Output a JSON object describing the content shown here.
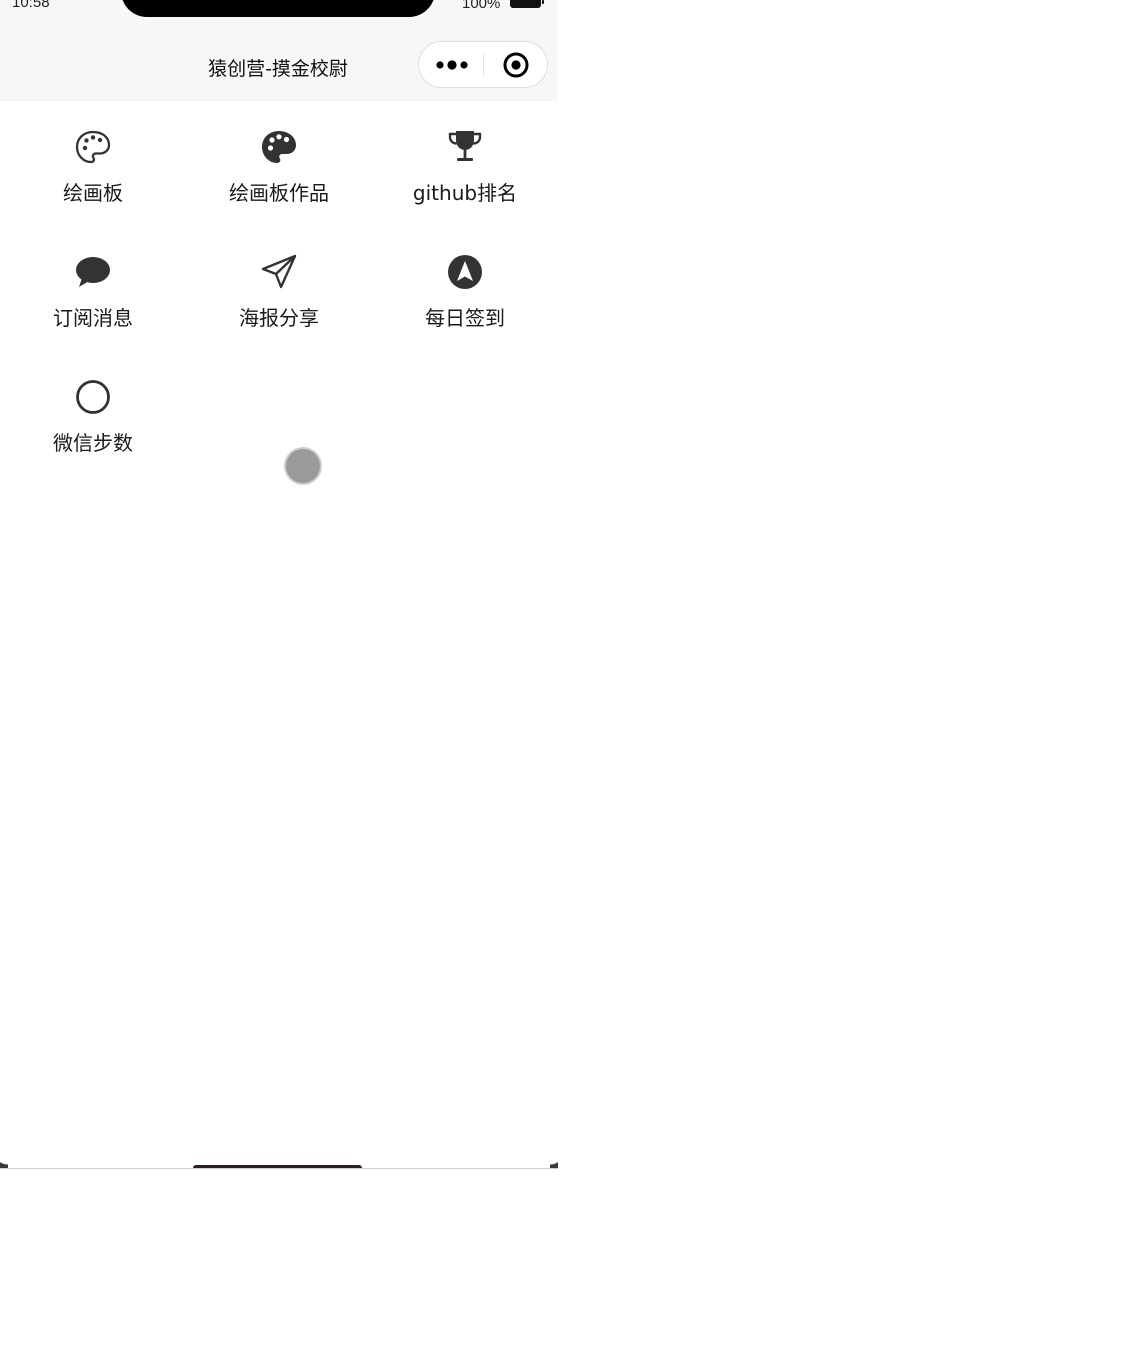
{
  "status_bar": {
    "time": "10:58",
    "battery_text": "100%"
  },
  "nav": {
    "title": "猿创营-摸金校尉",
    "more_icon": "more-dots-icon",
    "close_icon": "target-close-icon"
  },
  "menu": {
    "items": [
      {
        "label": "绘画板",
        "icon": "palette-outline-icon"
      },
      {
        "label": "绘画板作品",
        "icon": "palette-filled-icon"
      },
      {
        "label": "github排名",
        "icon": "trophy-icon"
      },
      {
        "label": "订阅消息",
        "icon": "chat-bubble-icon"
      },
      {
        "label": "海报分享",
        "icon": "paper-plane-icon"
      },
      {
        "label": "每日签到",
        "icon": "navigation-arrow-icon"
      },
      {
        "label": "微信步数",
        "icon": "circle-outline-icon"
      }
    ]
  },
  "colors": {
    "navbar_bg": "#f6f7f6",
    "icon": "#333333",
    "text": "#1a1a1a"
  }
}
